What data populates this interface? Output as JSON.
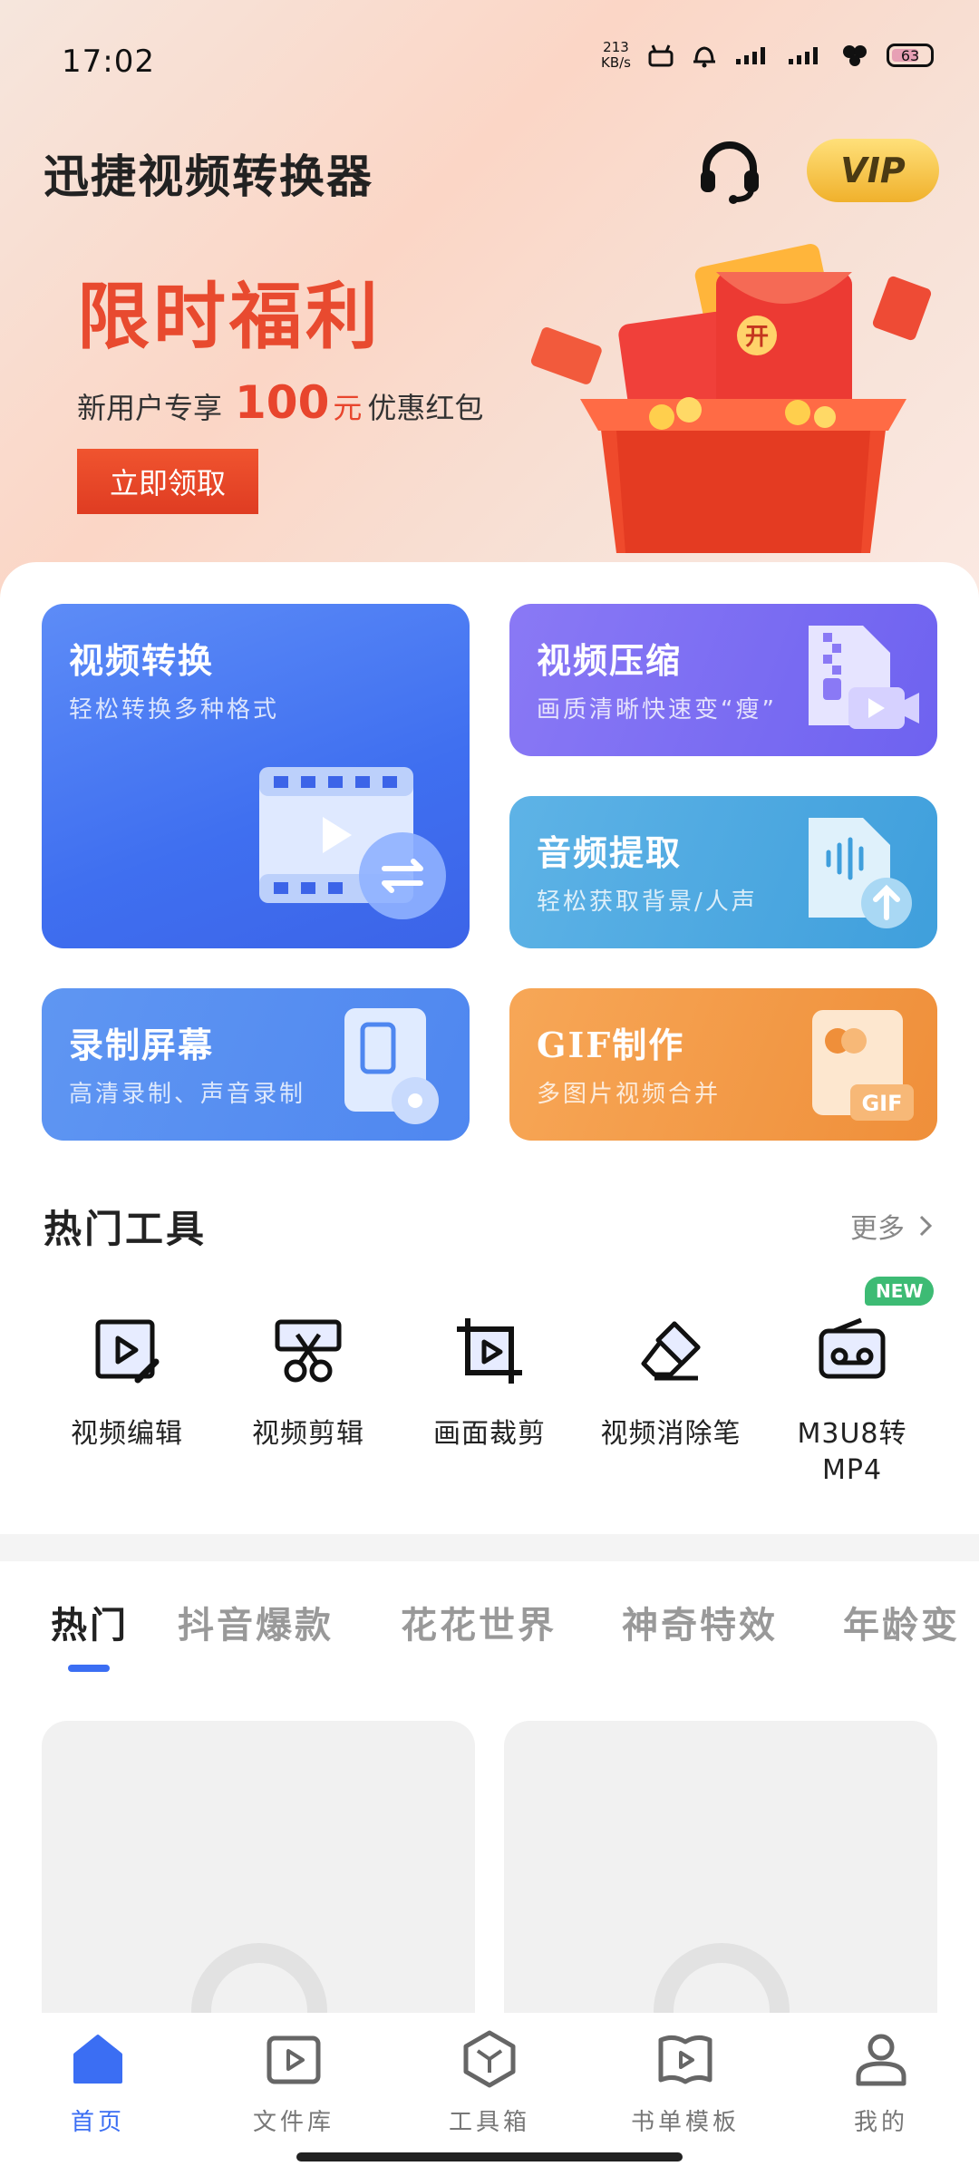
{
  "status_bar": {
    "time": "17:02",
    "net_speed_top": "213",
    "net_speed_bottom": "KB/s",
    "signal": "ull ull",
    "battery": "63"
  },
  "header": {
    "app_title": "迅捷视频转换器",
    "vip_label": "VIP"
  },
  "banner": {
    "title": "限时福利",
    "subtitle_prefix": "新用户专享",
    "amount": "100",
    "unit": "元",
    "subtitle_suffix": "优惠红包",
    "button": "立即领取",
    "packet_char": "开"
  },
  "feature_cards": {
    "convert": {
      "title": "视频转换",
      "subtitle": "轻松转换多种格式"
    },
    "compress": {
      "title": "视频压缩",
      "subtitle": "画质清晰快速变“瘦”"
    },
    "audio": {
      "title": "音频提取",
      "subtitle": "轻松获取背景/人声"
    },
    "record": {
      "title": "录制屏幕",
      "subtitle": "高清录制、声音录制"
    },
    "gif": {
      "title": "GIF制作",
      "subtitle": "多图片视频合并",
      "badge": "GIF"
    }
  },
  "hot_tools": {
    "title": "热门工具",
    "more": "更多",
    "new_badge": "NEW",
    "items": [
      {
        "label": "视频编辑",
        "icon": "video-edit-icon"
      },
      {
        "label": "视频剪辑",
        "icon": "scissors-icon"
      },
      {
        "label": "画面裁剪",
        "icon": "crop-icon"
      },
      {
        "label": "视频消除笔",
        "icon": "eraser-icon"
      },
      {
        "label": "M3U8转MP4",
        "label_line1": "M3U8转",
        "label_line2": "MP4",
        "icon": "cassette-icon"
      }
    ]
  },
  "category_tabs": [
    "热门",
    "抖音爆款",
    "花花世界",
    "神奇特效",
    "年龄变"
  ],
  "bottom_nav": [
    {
      "label": "首页",
      "icon": "home-icon",
      "active": true
    },
    {
      "label": "文件库",
      "icon": "play-folder-icon"
    },
    {
      "label": "工具箱",
      "icon": "toolbox-icon"
    },
    {
      "label": "书单模板",
      "icon": "book-template-icon"
    },
    {
      "label": "我的",
      "icon": "profile-icon"
    }
  ],
  "colors": {
    "accent_blue": "#3b6ef3",
    "promo_red": "#e84a2f",
    "vip_gold": "#f0b12c",
    "new_green": "#3dbb74"
  }
}
